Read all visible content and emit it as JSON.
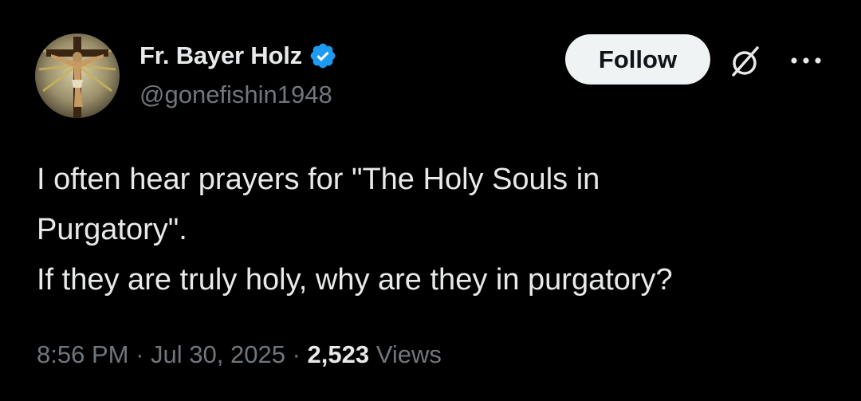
{
  "author": {
    "display_name": "Fr. Bayer Holz",
    "handle": "@gonefishin1948",
    "verified_color": "#1d9bf0",
    "avatar_icon": "crucifix-avatar"
  },
  "actions": {
    "follow_label": "Follow",
    "grok_icon": "grok-icon",
    "more_icon": "more-icon"
  },
  "tweet": {
    "lines": [
      "I often hear prayers for \"The Holy Souls in",
      "Purgatory\".",
      "If they are truly holy, why are they in purgatory?"
    ]
  },
  "meta": {
    "time": "8:56 PM",
    "separator": "·",
    "date": "Jul 30, 2025",
    "views_count": "2,523",
    "views_label": "Views"
  },
  "colors": {
    "background": "#000000",
    "primary_text": "#e7e9ea",
    "secondary_text": "#71767b",
    "follow_bg": "#eff3f4",
    "accent": "#1d9bf0"
  }
}
